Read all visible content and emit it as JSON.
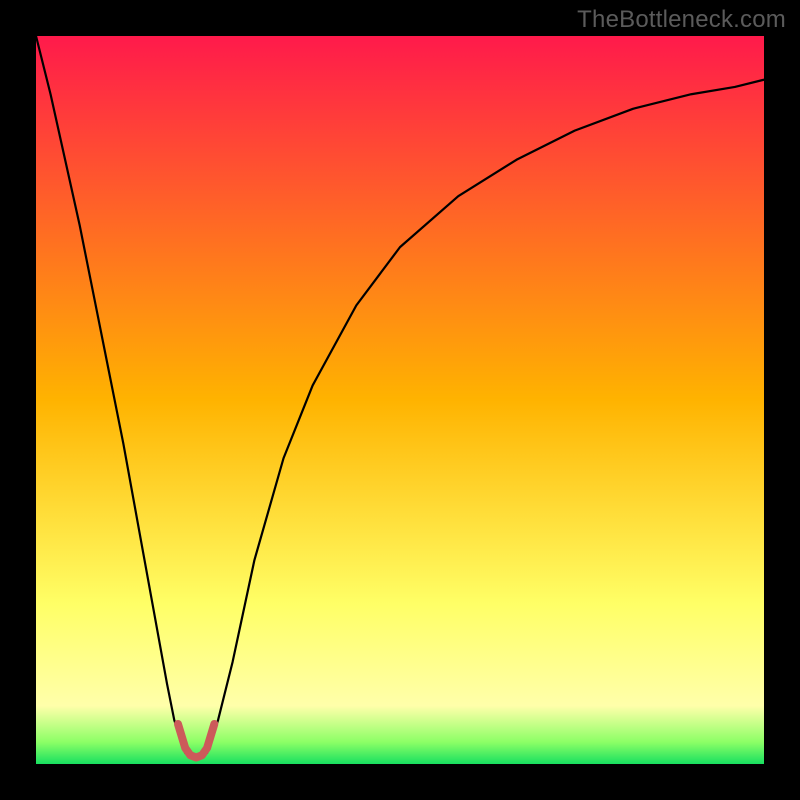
{
  "watermark": {
    "text": "TheBottleneck.com"
  },
  "chart_data": {
    "type": "line",
    "title": "",
    "xlabel": "",
    "ylabel": "",
    "xlim": [
      0,
      100
    ],
    "ylim": [
      0,
      100
    ],
    "grid": false,
    "background_gradient": {
      "stops": [
        {
          "pos": 0.0,
          "color": "#ff1a4b"
        },
        {
          "pos": 0.5,
          "color": "#ffb300"
        },
        {
          "pos": 0.78,
          "color": "#ffff66"
        },
        {
          "pos": 0.92,
          "color": "#ffffaa"
        },
        {
          "pos": 0.97,
          "color": "#8cff66"
        },
        {
          "pos": 1.0,
          "color": "#18e060"
        }
      ]
    },
    "optimum_x": 22,
    "series": [
      {
        "name": "bottleneck-curve",
        "color": "#000000",
        "width": 2.2,
        "x": [
          0,
          2,
          4,
          6,
          8,
          10,
          12,
          14,
          16,
          18,
          19,
          20.5,
          22,
          23.5,
          25,
          27,
          30,
          34,
          38,
          44,
          50,
          58,
          66,
          74,
          82,
          90,
          96,
          100
        ],
        "values": [
          100,
          92,
          83,
          74,
          64,
          54,
          44,
          33,
          22,
          11,
          6,
          1.5,
          1,
          1.5,
          6,
          14,
          28,
          42,
          52,
          63,
          71,
          78,
          83,
          87,
          90,
          92,
          93,
          94
        ]
      }
    ],
    "clamp": {
      "color": "#cc5a5a",
      "width": 8,
      "x": [
        19.5,
        20.5,
        21.2,
        22,
        22.8,
        23.5,
        24.5
      ],
      "values": [
        5.5,
        2.2,
        1.2,
        0.9,
        1.2,
        2.2,
        5.5
      ]
    }
  }
}
